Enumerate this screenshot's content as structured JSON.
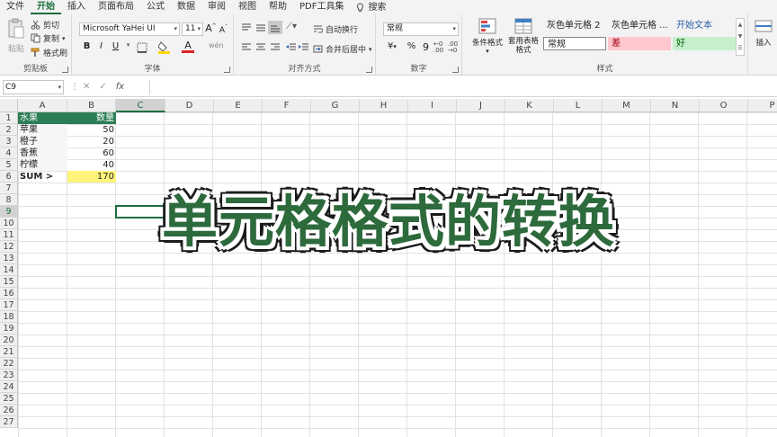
{
  "tabs": [
    "文件",
    "开始",
    "插入",
    "页面布局",
    "公式",
    "数据",
    "审阅",
    "视图",
    "帮助",
    "PDF工具集",
    "搜索"
  ],
  "ribbon": {
    "clipboard": {
      "paste": "粘贴",
      "cut": "剪切",
      "copy": "复制",
      "format_painter": "格式刷",
      "label": "剪贴板"
    },
    "font": {
      "name": "Microsoft YaHei UI",
      "size": "11",
      "grow": "A",
      "shrink": "A",
      "bold": "B",
      "italic": "I",
      "underline": "U",
      "label": "字体",
      "fill_color": "#ffd400",
      "font_color": "#e02020"
    },
    "alignment": {
      "wrap": "自动换行",
      "merge": "合并后居中",
      "label": "对齐方式"
    },
    "number": {
      "format": "常规",
      "currency": "¥",
      "percent": "%",
      "comma": "9",
      "label": "数字"
    },
    "styles": {
      "conditional": "条件格式",
      "table_format": "套用表格格式",
      "cells": [
        {
          "text": "灰色单元格 2",
          "color": "#222222",
          "bg": "#ffffff"
        },
        {
          "text": "灰色单元格 ...",
          "color": "#222222",
          "bg": "#ffffff"
        },
        {
          "text": "开始文本",
          "color": "#2b5fa8",
          "bg": "#ffffff"
        },
        {
          "text": "常规",
          "color": "#222222",
          "bg": "#ffffff"
        },
        {
          "text": "差",
          "color": "#9c0006",
          "bg": "#ffc7ce"
        },
        {
          "text": "好",
          "color": "#006100",
          "bg": "#c6efce"
        }
      ],
      "label": "样式"
    },
    "insert": "插入"
  },
  "formula_bar": {
    "name_box": "C9",
    "cancel": "✕",
    "enter": "✓",
    "fx": "fx",
    "value": ""
  },
  "columns": [
    "A",
    "B",
    "C",
    "D",
    "E",
    "F",
    "G",
    "H",
    "I",
    "J",
    "K",
    "L",
    "M",
    "N",
    "O",
    "P"
  ],
  "rows": [
    "1",
    "2",
    "3",
    "4",
    "5",
    "6",
    "7",
    "8",
    "9",
    "10",
    "11",
    "12",
    "13",
    "14",
    "15",
    "16",
    "17",
    "18",
    "19",
    "20",
    "21",
    "22",
    "23",
    "24",
    "25",
    "26",
    "27"
  ],
  "data": {
    "header": [
      "水果",
      "数量"
    ],
    "rows": [
      [
        "苹果",
        "50"
      ],
      [
        "橙子",
        "20"
      ],
      [
        "香蕉",
        "60"
      ],
      [
        "柠檬",
        "40"
      ]
    ],
    "sum_label": "SUM >",
    "sum_value": "170"
  },
  "overlay": "单元格格式的转换"
}
